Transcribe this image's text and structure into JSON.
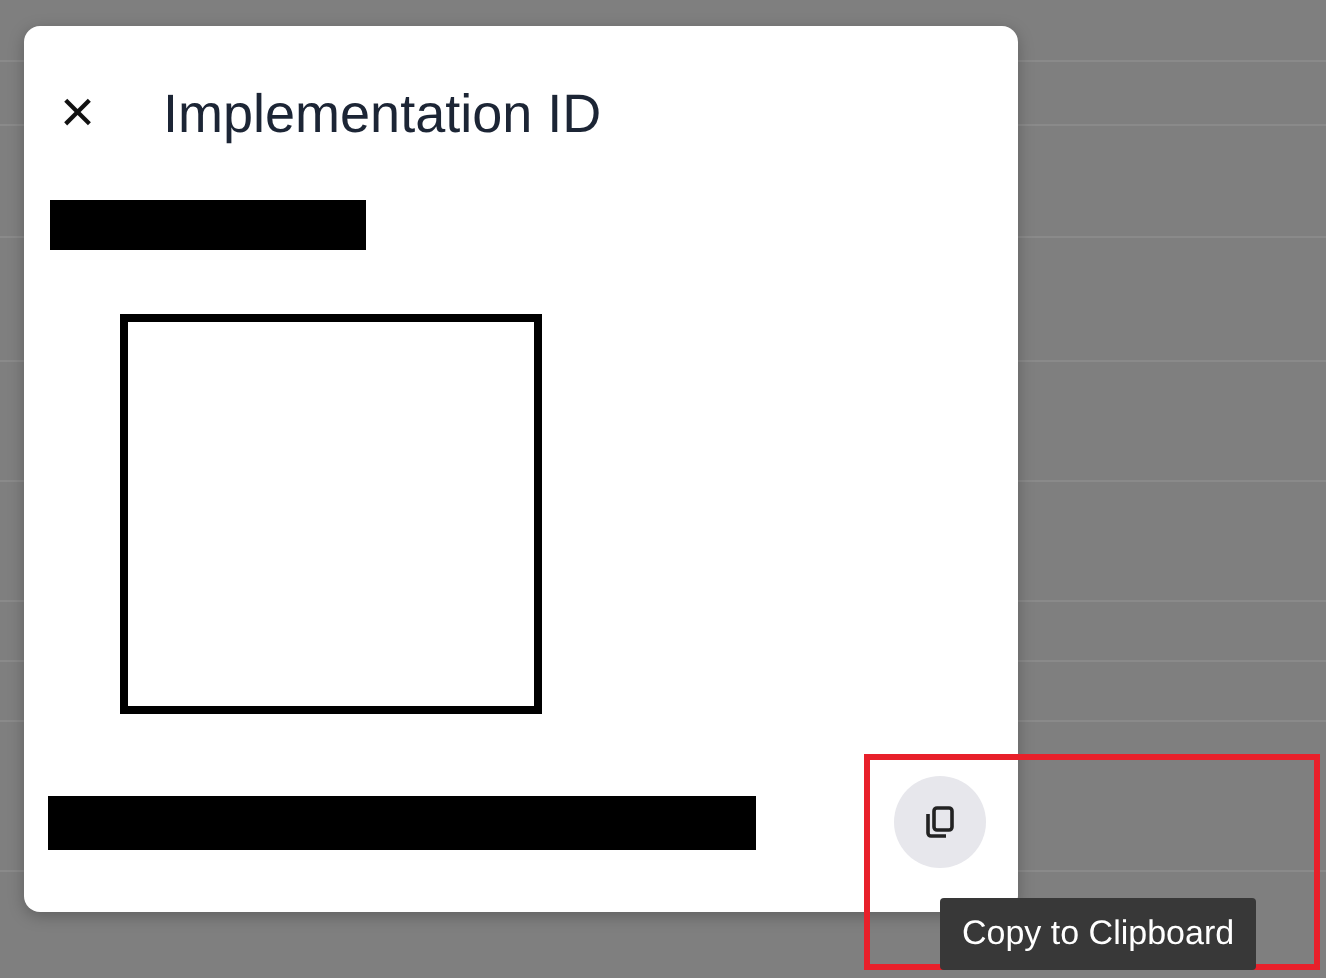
{
  "dialog": {
    "title": "Implementation ID",
    "close": "×"
  },
  "id_label": {
    "redacted": true
  },
  "id_value": {
    "redacted": true
  },
  "copy_button": {
    "tooltip": "Copy to Clipboard"
  }
}
